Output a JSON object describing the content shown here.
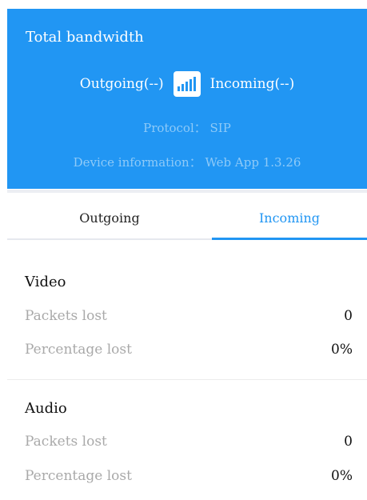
{
  "header": {
    "title": "Total bandwidth",
    "outgoing": "Outgoing(--)",
    "incoming": "Incoming(--)",
    "signal_icon": "signal-bars-icon",
    "protocol": "Protocol： SIP",
    "device_info": "Device information： Web App 1.3.26",
    "background_color": "#2196f3"
  },
  "tabs": {
    "items": [
      {
        "label": "Outgoing",
        "active": false
      },
      {
        "label": "Incoming",
        "active": true
      }
    ],
    "active_color": "#2196f3"
  },
  "video": {
    "title": "Video",
    "packets_lost_label": "Packets lost",
    "packets_lost_value": "0",
    "percentage_lost_label": "Percentage lost",
    "percentage_lost_value": "0%"
  },
  "audio": {
    "title": "Audio",
    "packets_lost_label": "Packets lost",
    "packets_lost_value": "0",
    "percentage_lost_label": "Percentage lost",
    "percentage_lost_value": "0%"
  }
}
